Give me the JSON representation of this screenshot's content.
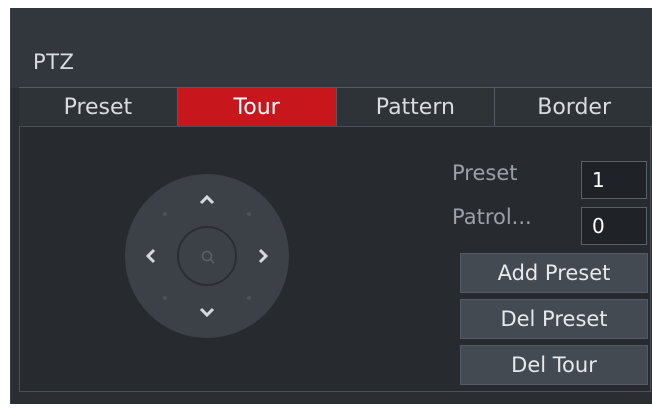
{
  "window": {
    "title": "PTZ"
  },
  "tabs": [
    {
      "label": "Preset",
      "active": false
    },
    {
      "label": "Tour",
      "active": true
    },
    {
      "label": "Pattern",
      "active": false
    },
    {
      "label": "Border",
      "active": false
    }
  ],
  "fields": {
    "preset": {
      "label": "Preset",
      "value": "1"
    },
    "patrol": {
      "label": "Patrol...",
      "value": "0"
    }
  },
  "buttons": {
    "add_preset": "Add Preset",
    "del_preset": "Del Preset",
    "del_tour": "Del Tour"
  },
  "icons": {
    "up": "chevron-up-icon",
    "down": "chevron-down-icon",
    "left": "chevron-left-icon",
    "right": "chevron-right-icon",
    "center": "zoom-icon"
  },
  "colors": {
    "active_tab": "#c8161d",
    "background": "#2a2e33",
    "button": "#444a51"
  }
}
